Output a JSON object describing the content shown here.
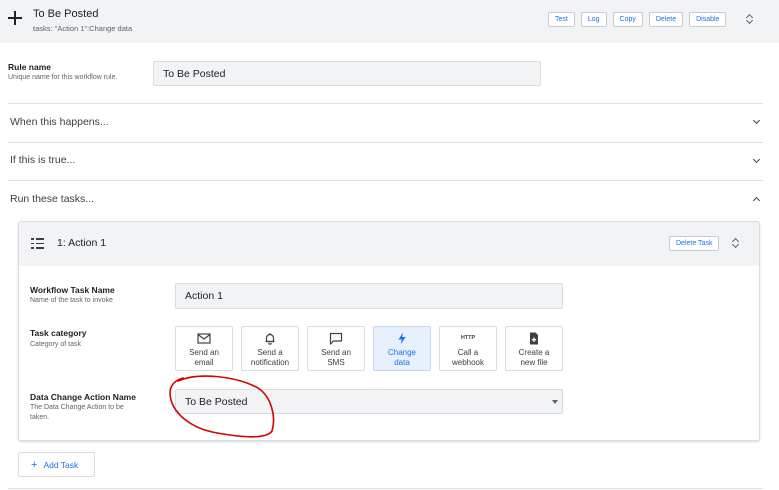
{
  "header": {
    "title": "To Be Posted",
    "subtitle": "tasks: \"Action 1\":Change data",
    "buttons": [
      "Test",
      "Log",
      "Copy",
      "Delete",
      "Disable"
    ]
  },
  "rule_name": {
    "label": "Rule name",
    "description": "Unique name for this workflow rule.",
    "value": "To Be Posted"
  },
  "sections": {
    "when": "When this happens...",
    "if": "If this is true...",
    "run": "Run these tasks..."
  },
  "task": {
    "title": "1: Action 1",
    "delete_label": "Delete Task",
    "name_label": "Workflow Task Name",
    "name_description": "Name of the task to invoke",
    "name_value": "Action 1",
    "category_label": "Task category",
    "category_description": "Category of task",
    "categories": [
      {
        "label_line1": "Send an",
        "label_line2": "email",
        "icon": "mail-icon"
      },
      {
        "label_line1": "Send a",
        "label_line2": "notification",
        "icon": "bell-icon"
      },
      {
        "label_line1": "Send an",
        "label_line2": "SMS",
        "icon": "chat-icon"
      },
      {
        "label_line1": "Change",
        "label_line2": "data",
        "icon": "bolt-icon",
        "selected": true
      },
      {
        "label_line1": "Call a",
        "label_line2": "webhook",
        "icon": "http-icon",
        "icon_text": "HTTP"
      },
      {
        "label_line1": "Create a",
        "label_line2": "new file",
        "icon": "file-add-icon"
      }
    ],
    "action_label": "Data Change Action Name",
    "action_description_line1": "The Data Change Action to be",
    "action_description_line2": "taken.",
    "action_value": "To Be Posted"
  },
  "add_task_label": "Add Task",
  "colors": {
    "accent": "#1a73e8",
    "header_bg": "#f1f3f4",
    "selected_bg": "#e8f0fe",
    "annotation": "#d50000"
  }
}
